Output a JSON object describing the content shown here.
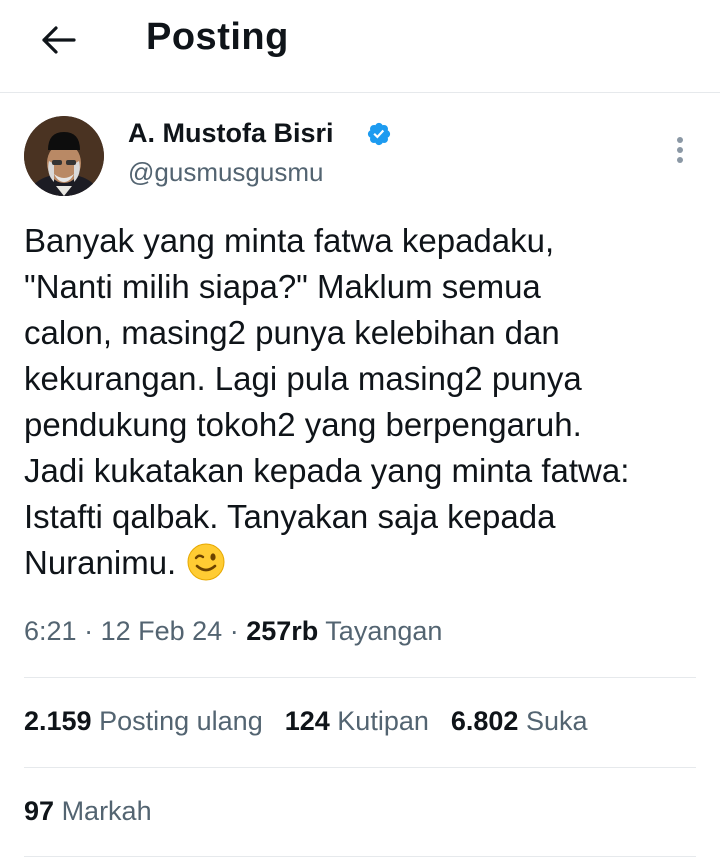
{
  "header": {
    "title": "Posting",
    "back_icon": "arrow-left-icon"
  },
  "author": {
    "display_name": "A. Mustofa Bisri",
    "handle": "@gusmusgusmu",
    "verified": true,
    "verified_color": "#1d9bf0"
  },
  "tweet": {
    "lines": [
      "Banyak yang minta fatwa kepadaku,",
      "\"Nanti milih siapa?\" Maklum semua",
      "calon, masing2 punya kelebihan dan",
      "kekurangan. Lagi pula masing2 punya",
      "pendukung tokoh2 yang berpengaruh.",
      "Jadi kukatakan kepada yang minta fatwa:",
      "Istafti qalbak. Tanyakan saja kepada",
      "Nuranimu."
    ],
    "emoji": "winking-face-emoji"
  },
  "meta": {
    "time": "6:21",
    "sep1": "·",
    "date": "12 Feb 24",
    "sep2": "·",
    "views_count": "257rb",
    "views_label": "Tayangan"
  },
  "stats": {
    "reposts_count": "2.159",
    "reposts_label": "Posting ulang",
    "quotes_count": "124",
    "quotes_label": "Kutipan",
    "likes_count": "6.802",
    "likes_label": "Suka",
    "bookmarks_count": "97",
    "bookmarks_label": "Markah"
  },
  "colors": {
    "text_primary": "#0f1419",
    "text_secondary": "#536471",
    "divider": "#e6e9ec"
  }
}
